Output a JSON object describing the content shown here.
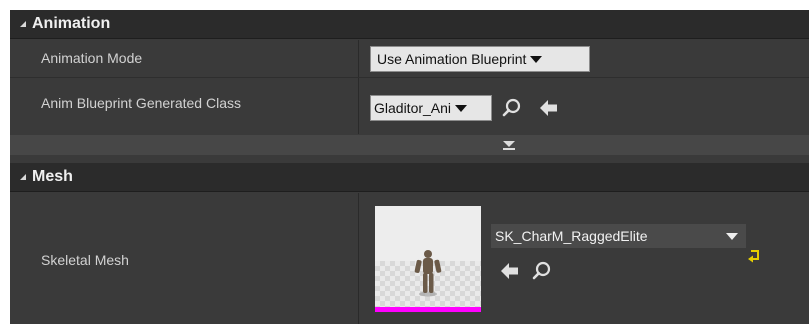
{
  "sections": [
    {
      "title": "Animation",
      "rows": [
        {
          "label": "Animation Mode",
          "value": "Use Animation Blueprint"
        },
        {
          "label": "Anim Blueprint Generated Class",
          "value": "Gladitor_Ani"
        }
      ]
    },
    {
      "title": "Mesh",
      "rows": [
        {
          "label": "Skeletal Mesh",
          "value": "SK_CharM_RaggedElite"
        }
      ]
    }
  ],
  "icons": {
    "browse": "search-icon",
    "use_selected": "left-arrow-icon",
    "expand": "chevron-down-icon",
    "reset": "reset-arrow-icon"
  },
  "colors": {
    "panel_bg": "#3a3a3a",
    "header_bg": "#2b2b2b",
    "combo_bg": "#e6e6e6",
    "thumbnail_strip": "#ff00ff",
    "reset_icon": "#e6cf00"
  }
}
